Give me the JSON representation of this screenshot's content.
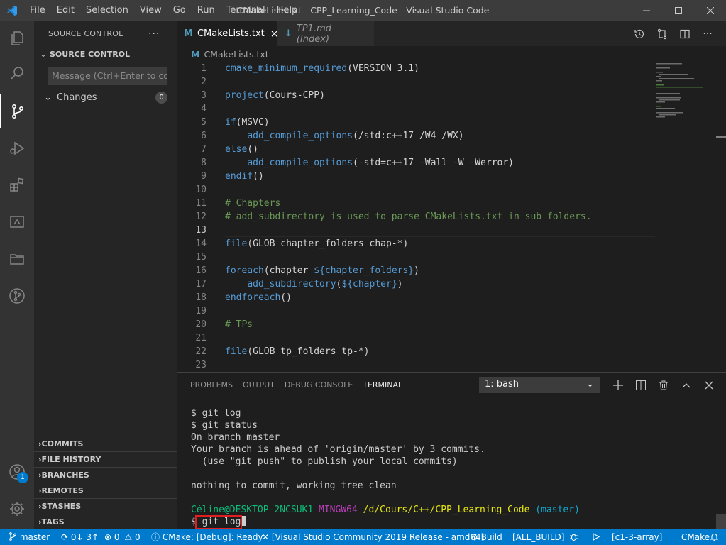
{
  "titlebar": {
    "menu": [
      "File",
      "Edit",
      "Selection",
      "View",
      "Go",
      "Run",
      "Terminal",
      "Help"
    ],
    "window_title": "CMakeLists.txt - CPP_Learning_Code - Visual Studio Code"
  },
  "activity": {
    "accounts_badge": "1"
  },
  "sidebar": {
    "title": "SOURCE CONTROL",
    "section": "SOURCE CONTROL",
    "message_placeholder": "Message (Ctrl+Enter to co...",
    "changes_label": "Changes",
    "changes_count": "0",
    "bottom_sections": [
      "COMMITS",
      "FILE HISTORY",
      "BRANCHES",
      "REMOTES",
      "STASHES",
      "TAGS"
    ]
  },
  "tabs": [
    {
      "icon": "M",
      "label": "CMakeLists.txt",
      "active": true
    },
    {
      "icon": "↓",
      "label": "TP1.md (Index)",
      "active": false
    }
  ],
  "breadcrumb": {
    "icon": "M",
    "label": "CMakeLists.txt"
  },
  "code_lines": [
    "cmake_minimum_required(VERSION 3.1)",
    "",
    "project(Cours-CPP)",
    "",
    "if(MSVC)",
    "    add_compile_options(/std:c++17 /W4 /WX)",
    "else()",
    "    add_compile_options(-std=c++17 -Wall -W -Werror)",
    "endif()",
    "",
    "# Chapters",
    "# add_subdirectory is used to parse CMakeLists.txt in sub folders.",
    "",
    "file(GLOB chapter_folders chap-*)",
    "",
    "foreach(chapter ${chapter_folders})",
    "    add_subdirectory(${chapter})",
    "endforeach()",
    "",
    "# TPs",
    "",
    "file(GLOB tp_folders tp-*)",
    ""
  ],
  "panel": {
    "tabs": [
      "PROBLEMS",
      "OUTPUT",
      "DEBUG CONSOLE",
      "TERMINAL"
    ],
    "active_tab": "TERMINAL",
    "terminal_select": "1: bash",
    "terminal_lines": [
      "$ git log",
      "$ git status",
      "On branch master",
      "Your branch is ahead of 'origin/master' by 3 commits.",
      "  (use \"git push\" to publish your local commits)",
      "",
      "nothing to commit, working tree clean",
      ""
    ],
    "prompt": {
      "user_host": "Céline@DESKTOP-2NCSUK1",
      "shell": "MINGW64",
      "path": "/d/Cours/C++/CPP_Learning_Code",
      "branch": "(master)"
    },
    "current_command": "git log"
  },
  "status": {
    "branch": "master",
    "sync": "0↓ 3↑",
    "errors": "0",
    "warnings": "0",
    "cmake": "CMake: [Debug]: Ready",
    "kit": "[Visual Studio Community 2019 Release - amd64]",
    "build": "Build",
    "target": "[ALL_BUILD]",
    "launch_target": "[c1-3-array]",
    "language": "CMake"
  },
  "colors": {
    "accent": "#007acc",
    "highlight_box": "#e02020"
  }
}
